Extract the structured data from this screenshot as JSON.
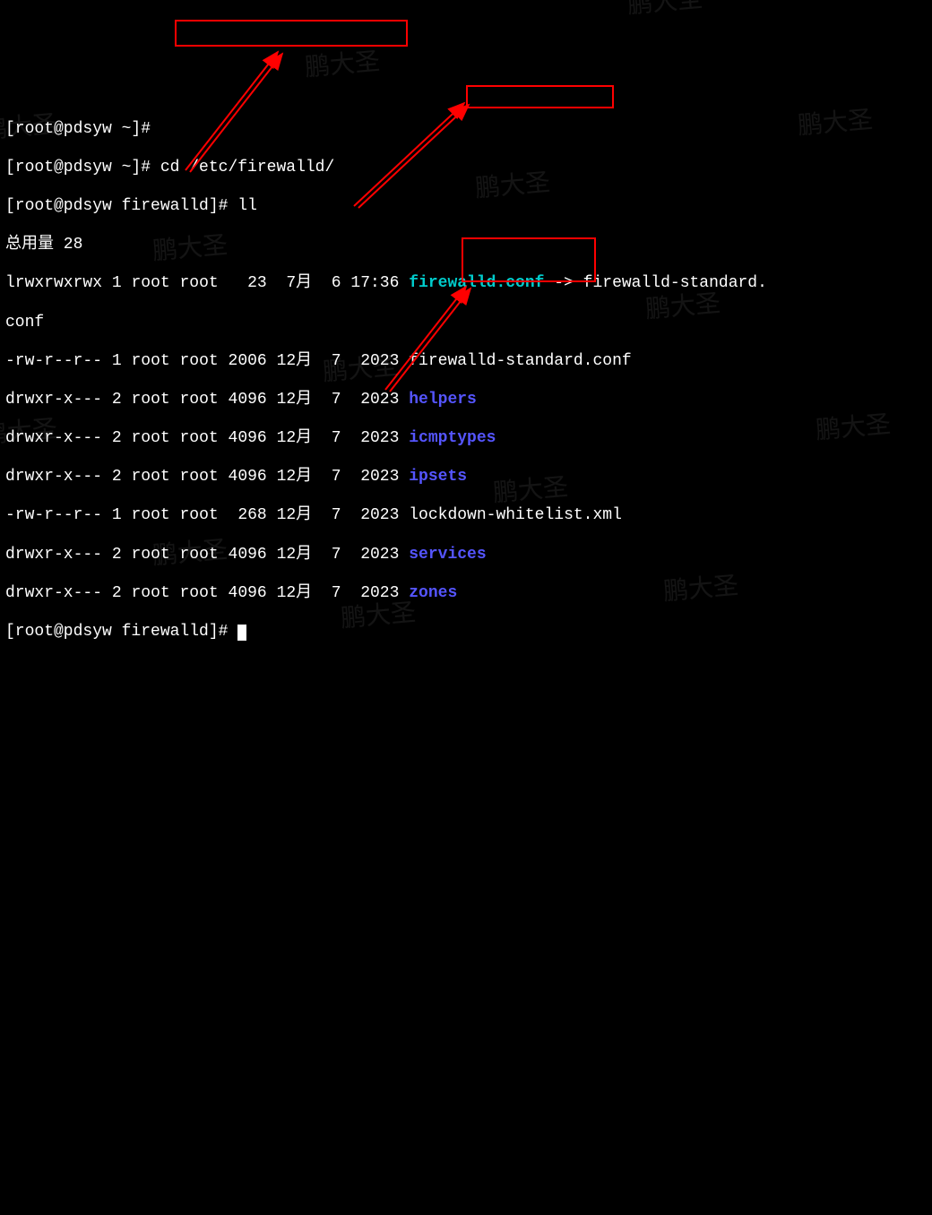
{
  "terminal": {
    "lines": [
      {
        "prompt": "[root@pdsyw ~]#",
        "command": ""
      },
      {
        "prompt": "[root@pdsyw ~]#",
        "command": "cd /etc/firewalld/"
      },
      {
        "prompt": "[root@pdsyw firewalld]#",
        "command": "ll"
      }
    ],
    "total_label": "总用量 28",
    "entries": [
      {
        "perm": "lrwxrwxrwx",
        "links": "1",
        "owner": "root",
        "group": "root",
        "size": "  23",
        "month": " 7月",
        "day": " 6",
        "time": "17:36",
        "name": "firewalld.conf",
        "arrow": " -> firewalld-standard.",
        "cont": "conf",
        "color": "cyan"
      },
      {
        "perm": "-rw-r--r--",
        "links": "1",
        "owner": "root",
        "group": "root",
        "size": "2006",
        "month": "12月",
        "day": " 7",
        "time": " 2023",
        "name": "firewalld-standard.conf",
        "color": "white"
      },
      {
        "perm": "drwxr-x---",
        "links": "2",
        "owner": "root",
        "group": "root",
        "size": "4096",
        "month": "12月",
        "day": " 7",
        "time": " 2023",
        "name": "helpers",
        "color": "blue"
      },
      {
        "perm": "drwxr-x---",
        "links": "2",
        "owner": "root",
        "group": "root",
        "size": "4096",
        "month": "12月",
        "day": " 7",
        "time": " 2023",
        "name": "icmptypes",
        "color": "blue"
      },
      {
        "perm": "drwxr-x---",
        "links": "2",
        "owner": "root",
        "group": "root",
        "size": "4096",
        "month": "12月",
        "day": " 7",
        "time": " 2023",
        "name": "ipsets",
        "color": "blue"
      },
      {
        "perm": "-rw-r--r--",
        "links": "1",
        "owner": "root",
        "group": "root",
        "size": " 268",
        "month": "12月",
        "day": " 7",
        "time": " 2023",
        "name": "lockdown-whitelist.xml",
        "color": "white"
      },
      {
        "perm": "drwxr-x---",
        "links": "2",
        "owner": "root",
        "group": "root",
        "size": "4096",
        "month": "12月",
        "day": " 7",
        "time": " 2023",
        "name": "services",
        "color": "blue"
      },
      {
        "perm": "drwxr-x---",
        "links": "2",
        "owner": "root",
        "group": "root",
        "size": "4096",
        "month": "12月",
        "day": " 7",
        "time": " 2023",
        "name": "zones",
        "color": "blue"
      }
    ],
    "final_prompt": "[root@pdsyw firewalld]#"
  },
  "watermark_text": "鹏大圣"
}
